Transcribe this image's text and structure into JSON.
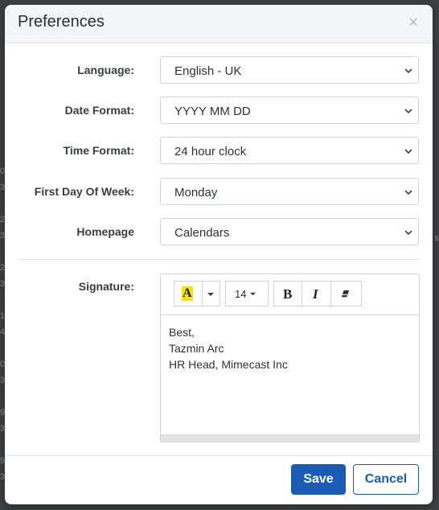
{
  "dialog": {
    "title": "Preferences",
    "close_glyph": "×"
  },
  "fields": [
    {
      "label": "Language:",
      "value": "English - UK"
    },
    {
      "label": "Date Format:",
      "value": "YYYY MM DD"
    },
    {
      "label": "Time Format:",
      "value": "24 hour clock"
    },
    {
      "label": "First Day Of Week:",
      "value": "Monday"
    },
    {
      "label": "Homepage",
      "value": "Calendars"
    }
  ],
  "signature": {
    "label": "Signature:",
    "toolbar": {
      "font_color_glyph": "A",
      "font_color_highlight": "#f5e400",
      "font_size_value": "14",
      "bold_glyph": "B",
      "italic_glyph": "I",
      "eraser_icon": "eraser-icon"
    },
    "lines": [
      "Best,",
      "Tazmin Arc",
      "HR Head, Mimecast Inc"
    ]
  },
  "actions": {
    "save_label": "Save",
    "cancel_label": "Cancel"
  },
  "colors": {
    "primary": "#1a5cb5",
    "backdrop": "#3d3f42"
  }
}
